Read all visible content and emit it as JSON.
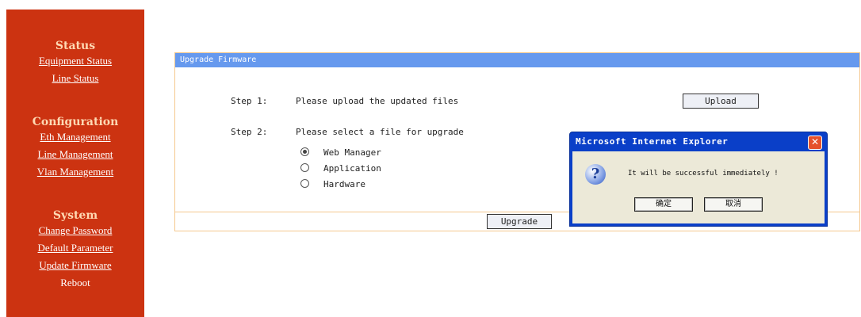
{
  "sidebar": {
    "status": {
      "title": "Status",
      "items": [
        "Equipment Status",
        "Line Status"
      ]
    },
    "configuration": {
      "title": "Configuration",
      "items": [
        "Eth Management",
        "Line Management",
        "Vlan Management"
      ]
    },
    "system": {
      "title": "System",
      "items": [
        "Change Password",
        "Default Parameter",
        "Update Firmware",
        "Reboot"
      ]
    }
  },
  "panel": {
    "title": "Upgrade Firmware",
    "step1_label": "Step 1:",
    "step1_text": "Please upload the updated files",
    "upload_label": "Upload",
    "step2_label": "Step 2:",
    "step2_text": "Please select a file for upgrade",
    "options": [
      {
        "label": "Web Manager",
        "checked": true
      },
      {
        "label": "Application",
        "checked": false
      },
      {
        "label": "Hardware",
        "checked": false
      }
    ],
    "upgrade_label": "Upgrade"
  },
  "dialog": {
    "title": "Microsoft Internet Explorer",
    "close_symbol": "✕",
    "icon_symbol": "?",
    "message": "It will be successful immediately !",
    "ok_label": "确定",
    "cancel_label": "取消"
  }
}
